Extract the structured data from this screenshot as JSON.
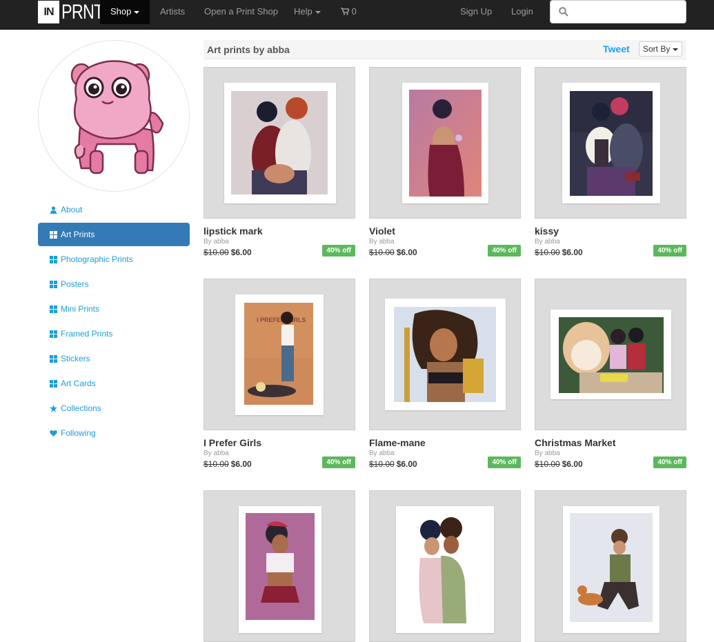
{
  "navbar": {
    "logo_in": "IN",
    "logo_prnt": "PRNT",
    "shop": "Shop",
    "artists": "Artists",
    "open_shop": "Open a Print Shop",
    "help": "Help",
    "cart_count": "0",
    "sign_up": "Sign Up",
    "login": "Login",
    "search_placeholder": ""
  },
  "sidebar": {
    "items": [
      {
        "label": "About",
        "icon": "user-icon"
      },
      {
        "label": "Art Prints",
        "icon": "grid-icon"
      },
      {
        "label": "Photographic Prints",
        "icon": "grid-icon"
      },
      {
        "label": "Posters",
        "icon": "grid-icon"
      },
      {
        "label": "Mini Prints",
        "icon": "grid-icon"
      },
      {
        "label": "Framed Prints",
        "icon": "grid-icon"
      },
      {
        "label": "Stickers",
        "icon": "grid-icon"
      },
      {
        "label": "Art Cards",
        "icon": "grid-icon"
      },
      {
        "label": "Collections",
        "icon": "star-icon"
      },
      {
        "label": "Following",
        "icon": "heart-icon"
      }
    ]
  },
  "main": {
    "title": "Art prints by abba",
    "tweet": "Tweet",
    "sort_label": "Sort By"
  },
  "products": [
    {
      "title": "lipstick mark",
      "by": "By abba",
      "old_price": "$10.00",
      "price": "$6.00",
      "badge": "40% off"
    },
    {
      "title": "Violet",
      "by": "By abba",
      "old_price": "$10.00",
      "price": "$6.00",
      "badge": "40% off"
    },
    {
      "title": "kissy",
      "by": "By abba",
      "old_price": "$10.00",
      "price": "$6.00",
      "badge": "40% off"
    },
    {
      "title": "I Prefer Girls",
      "by": "By abba",
      "old_price": "$10.00",
      "price": "$6.00",
      "badge": "40% off",
      "art_text": "I PREFER GIRLS"
    },
    {
      "title": "Flame-mane",
      "by": "By abba",
      "old_price": "$10.00",
      "price": "$6.00",
      "badge": "40% off"
    },
    {
      "title": "Christmas Market",
      "by": "By abba",
      "old_price": "$10.00",
      "price": "$6.00",
      "badge": "40% off"
    },
    {
      "title": "",
      "by": "",
      "old_price": "",
      "price": "",
      "badge": ""
    },
    {
      "title": "",
      "by": "",
      "old_price": "",
      "price": "",
      "badge": ""
    },
    {
      "title": "",
      "by": "",
      "old_price": "",
      "price": "",
      "badge": ""
    }
  ],
  "colors": {
    "navbar": "#222222",
    "active_nav": "#080808",
    "link": "#1e9dd8",
    "active_side": "#337ab7",
    "badge": "#5cb85c",
    "tweet": "#1da1f2"
  }
}
